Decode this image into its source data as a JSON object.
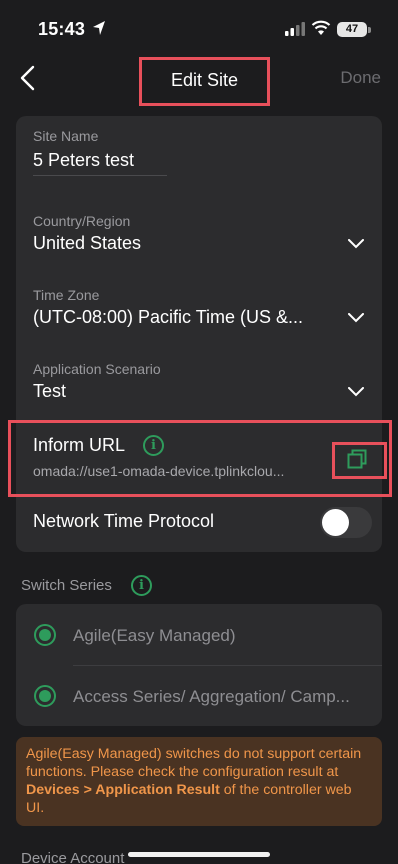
{
  "status_bar": {
    "time": "15:43",
    "battery": "47"
  },
  "nav": {
    "title": "Edit Site",
    "done_label": "Done"
  },
  "fields": {
    "site_name_label": "Site Name",
    "site_name_value": "5 Peters test",
    "country_label": "Country/Region",
    "country_value": "United States",
    "timezone_label": "Time Zone",
    "timezone_value": "(UTC-08:00) Pacific Time (US &...",
    "scenario_label": "Application Scenario",
    "scenario_value": "Test"
  },
  "inform": {
    "title": "Inform URL",
    "url": "omada://use1-omada-device.tplinkclou..."
  },
  "ntp": {
    "label": "Network Time Protocol",
    "enabled": false
  },
  "switch_series": {
    "title": "Switch Series",
    "options": [
      {
        "label": "Agile(Easy Managed)",
        "selected": true
      },
      {
        "label": "Access Series/ Aggregation/ Camp...",
        "selected": true
      }
    ]
  },
  "warning": {
    "text_1": "Agile(Easy Managed) switches do not support certain functions. Please check the configuration result at ",
    "bold": "Devices > Application Result",
    "text_2": " of the controller web UI."
  },
  "partial_label": "Device Account",
  "colors": {
    "accent": "#2e9c5c",
    "highlight": "#e8505b",
    "warning_text": "#f0964a",
    "warning_bg": "#4a3322"
  },
  "icons": [
    "location-arrow-icon",
    "signal-icon",
    "wifi-icon",
    "battery-icon",
    "back-chevron-icon",
    "chevron-down-icon",
    "info-icon",
    "copy-icon"
  ]
}
